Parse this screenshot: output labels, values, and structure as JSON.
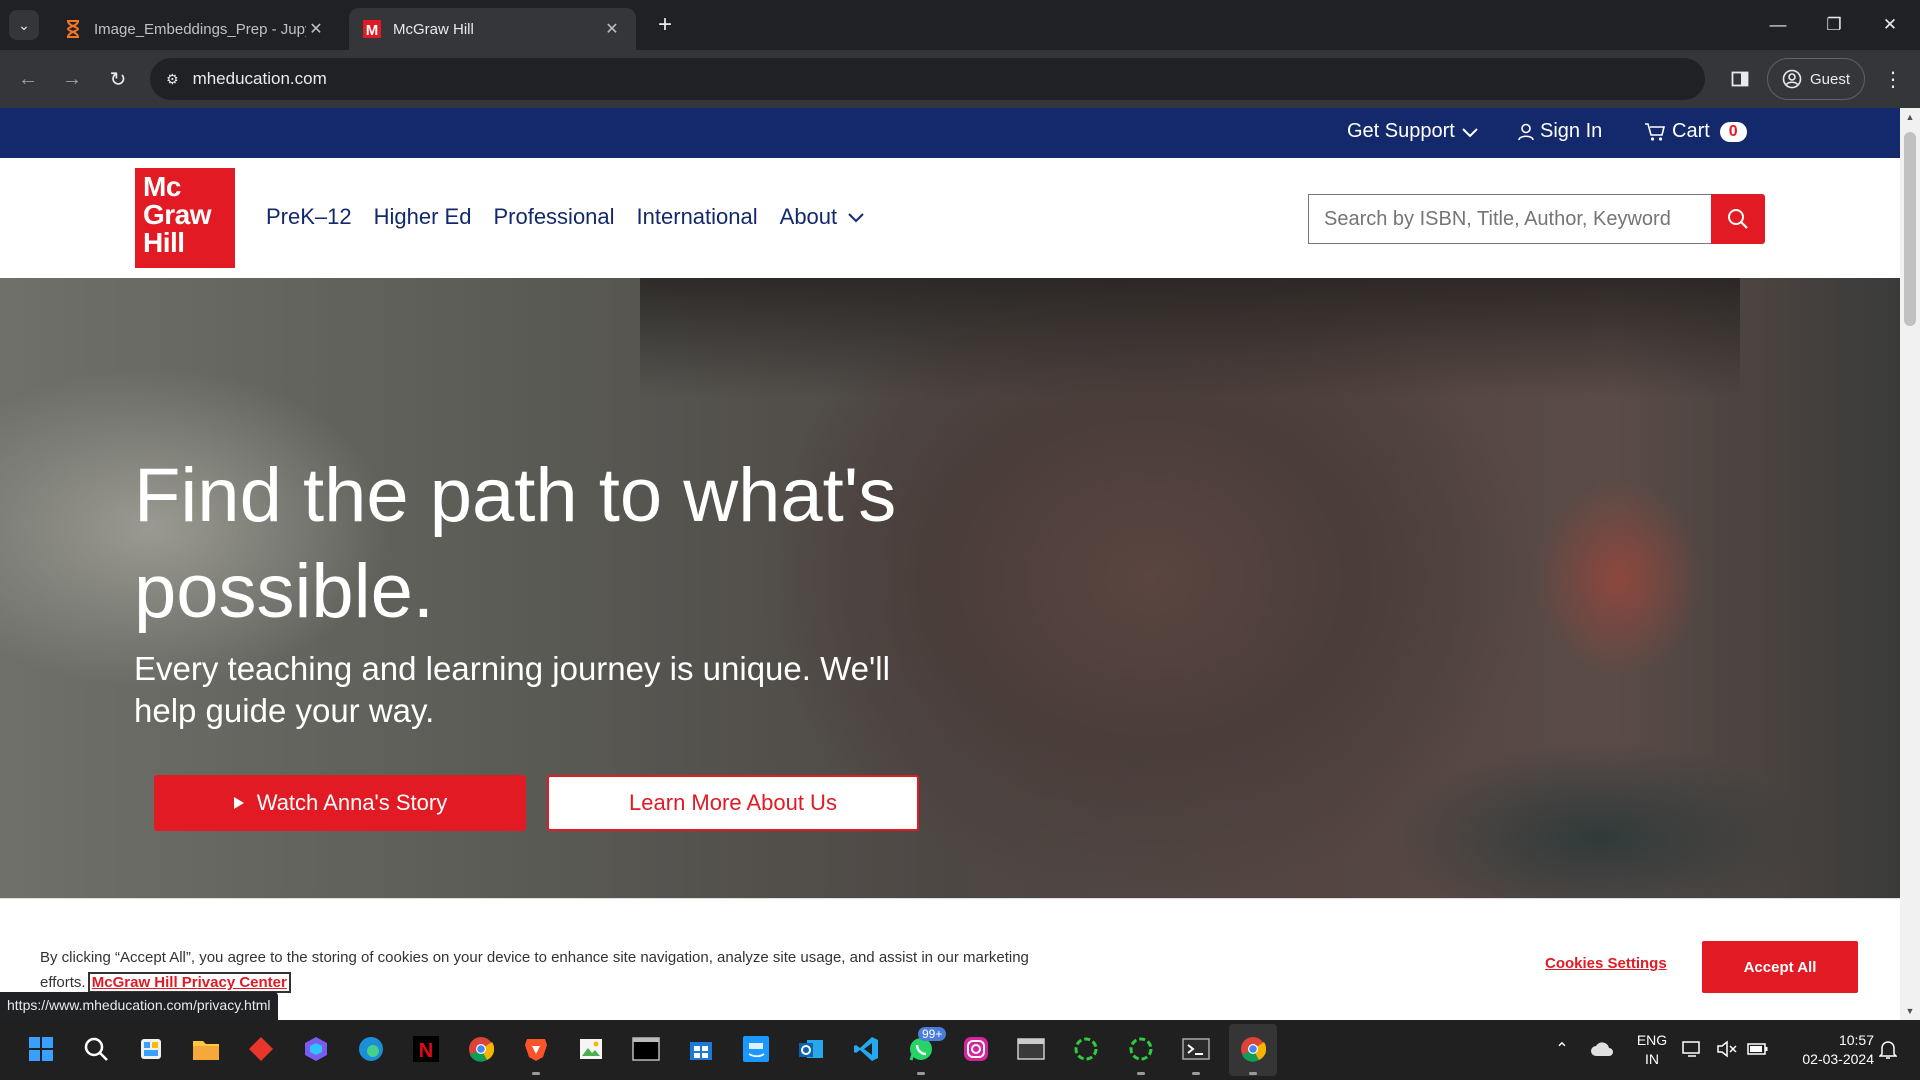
{
  "browser": {
    "tabs": [
      {
        "title": "Image_Embeddings_Prep - Jupy",
        "favicon": "hourglass-icon"
      },
      {
        "title": "McGraw Hill",
        "favicon": "mcgraw-hill-m-icon"
      }
    ],
    "active_tab": 1,
    "url": "mheducation.com",
    "profile_label": "Guest",
    "status_url": "https://www.mheducation.com/privacy.html"
  },
  "site": {
    "utility": {
      "support": "Get Support",
      "sign_in": "Sign In",
      "cart": "Cart",
      "cart_count": "0"
    },
    "logo": {
      "line1": "Mc",
      "line2": "Graw",
      "line3": "Hill"
    },
    "nav": [
      "PreK–12",
      "Higher Ed",
      "Professional",
      "International",
      "About"
    ],
    "search_placeholder": "Search by ISBN, Title, Author, Keyword",
    "hero": {
      "title": "Find the path to what's possible.",
      "subtitle": "Every teaching and learning journey is unique. We'll help guide your way.",
      "watch_btn": "Watch Anna's Story",
      "learn_btn": "Learn More About Us"
    },
    "cookie": {
      "text": "By clicking “Accept All”, you agree to the storing of cookies on your device to enhance site navigation, analyze site usage, and assist in our marketing efforts.",
      "privacy_link": "McGraw Hill Privacy Center",
      "settings": "Cookies Settings",
      "accept": "Accept All"
    }
  },
  "taskbar": {
    "whatsapp_badge": "99+",
    "lang_line1": "ENG",
    "lang_line2": "IN",
    "time": "10:57",
    "date": "02-03-2024"
  },
  "colors": {
    "brand_red": "#e21a23",
    "brand_navy": "#13296b"
  }
}
